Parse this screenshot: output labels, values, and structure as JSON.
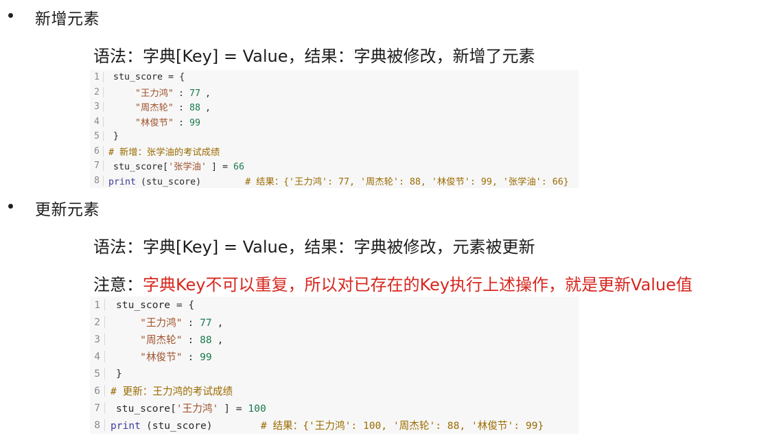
{
  "section1": {
    "heading": "新增元素",
    "syntax": "语法：字典[Key] = Value，结果：字典被修改，新增了元素",
    "code": [
      {
        "n": "1",
        "parts": [
          [
            "code",
            "stu_score = {"
          ]
        ]
      },
      {
        "n": "2",
        "parts": [
          [
            "code",
            "    "
          ],
          [
            "str",
            "\"王力鸿\""
          ],
          [
            "code",
            ": "
          ],
          [
            "num",
            "77"
          ],
          [
            "code",
            ","
          ]
        ]
      },
      {
        "n": "3",
        "parts": [
          [
            "code",
            "    "
          ],
          [
            "str",
            "\"周杰轮\""
          ],
          [
            "code",
            ": "
          ],
          [
            "num",
            "88"
          ],
          [
            "code",
            ","
          ]
        ]
      },
      {
        "n": "4",
        "parts": [
          [
            "code",
            "    "
          ],
          [
            "str",
            "\"林俊节\""
          ],
          [
            "code",
            ": "
          ],
          [
            "num",
            "99"
          ]
        ]
      },
      {
        "n": "5",
        "parts": [
          [
            "code",
            "}"
          ]
        ]
      },
      {
        "n": "6",
        "parts": [
          [
            "cmt",
            "# 新增：张学油的考试成绩"
          ]
        ]
      },
      {
        "n": "7",
        "parts": [
          [
            "code",
            "stu_score["
          ],
          [
            "str",
            "'张学油'"
          ],
          [
            "code",
            "] = "
          ],
          [
            "num",
            "66"
          ]
        ]
      },
      {
        "n": "8",
        "parts": [
          [
            "fn",
            "print"
          ],
          [
            "code",
            "(stu_score)        "
          ],
          [
            "cmt",
            "# 结果：{'王力鸿': 77, '周杰轮': 88, '林俊节': 99, '张学油': 66}"
          ]
        ]
      }
    ]
  },
  "section2": {
    "heading": "更新元素",
    "syntax": "语法：字典[Key] = Value，结果：字典被修改，元素被更新",
    "note_label": "注意：",
    "note_text": "字典Key不可以重复，所以对已存在的Key执行上述操作，就是更新Value值",
    "code": [
      {
        "n": "1",
        "parts": [
          [
            "code",
            "stu_score = {"
          ]
        ]
      },
      {
        "n": "2",
        "parts": [
          [
            "code",
            "    "
          ],
          [
            "str",
            "\"王力鸿\""
          ],
          [
            "code",
            ": "
          ],
          [
            "num",
            "77"
          ],
          [
            "code",
            ","
          ]
        ]
      },
      {
        "n": "3",
        "parts": [
          [
            "code",
            "    "
          ],
          [
            "str",
            "\"周杰轮\""
          ],
          [
            "code",
            ": "
          ],
          [
            "num",
            "88"
          ],
          [
            "code",
            ","
          ]
        ]
      },
      {
        "n": "4",
        "parts": [
          [
            "code",
            "    "
          ],
          [
            "str",
            "\"林俊节\""
          ],
          [
            "code",
            ": "
          ],
          [
            "num",
            "99"
          ]
        ]
      },
      {
        "n": "5",
        "parts": [
          [
            "code",
            "}"
          ]
        ]
      },
      {
        "n": "6",
        "parts": [
          [
            "cmt",
            "# 更新：王力鸿的考试成绩"
          ]
        ]
      },
      {
        "n": "7",
        "parts": [
          [
            "code",
            "stu_score["
          ],
          [
            "str",
            "'王力鸿'"
          ],
          [
            "code",
            "] = "
          ],
          [
            "num",
            "100"
          ]
        ]
      },
      {
        "n": "8",
        "parts": [
          [
            "fn",
            "print"
          ],
          [
            "code",
            "(stu_score)        "
          ],
          [
            "cmt",
            "# 结果：{'王力鸿': 100, '周杰轮': 88, '林俊节': 99}"
          ]
        ]
      }
    ]
  }
}
